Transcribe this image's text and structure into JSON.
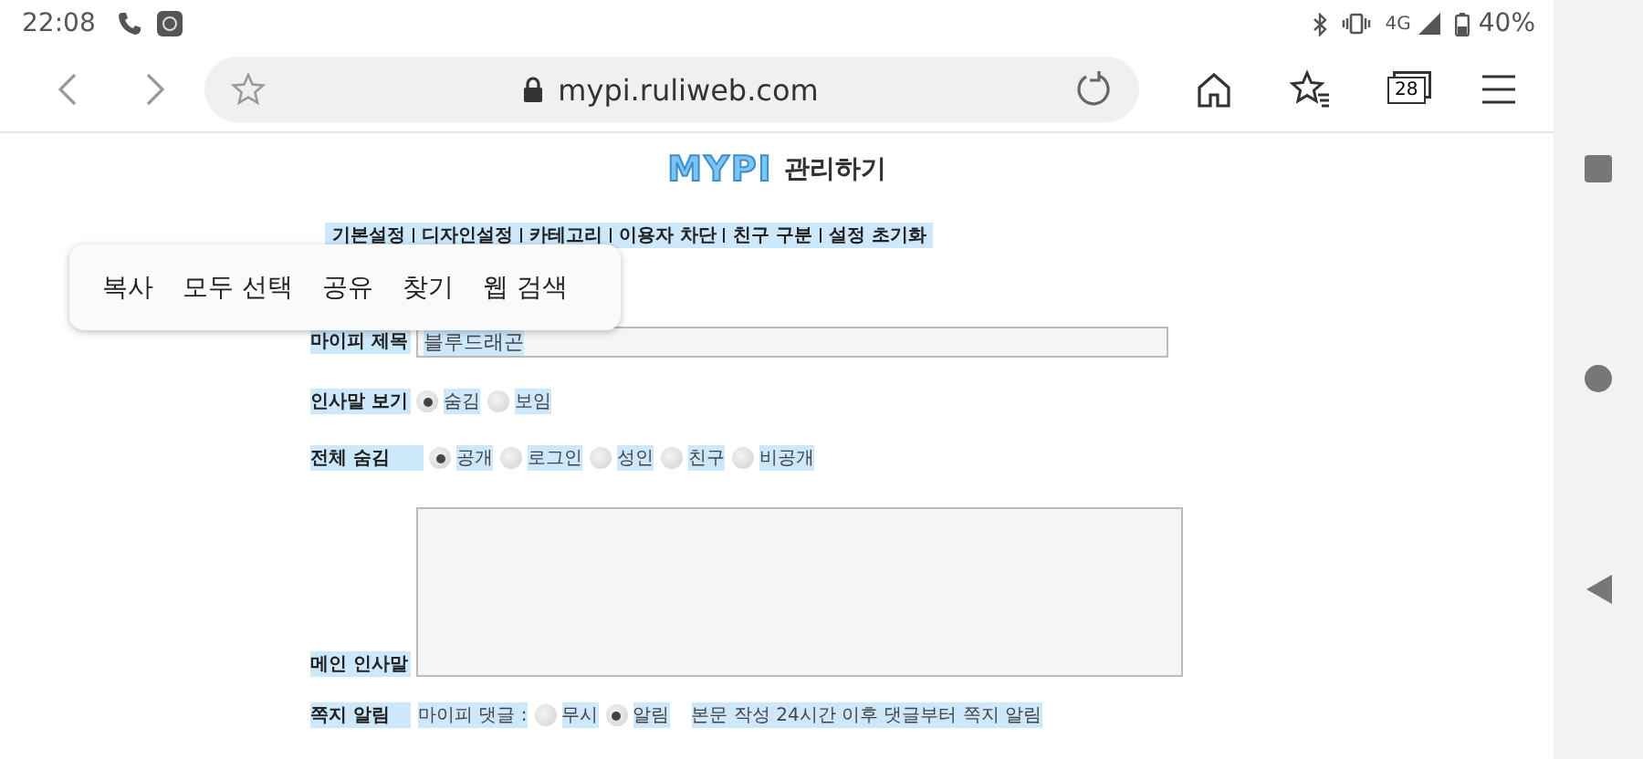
{
  "status_bar": {
    "time": "22:08",
    "network": "4G",
    "battery": "40%"
  },
  "browser": {
    "url": "mypi.ruliweb.com",
    "tab_count": "28"
  },
  "page": {
    "logo": "MYPI",
    "title": "관리하기",
    "menu": [
      "기본설정",
      "디자인설정",
      "카테고리",
      "이용자 차단",
      "친구 구분",
      "설정 초기화"
    ],
    "context_menu": [
      "복사",
      "모두 선택",
      "공유",
      "찾기",
      "웹 검색"
    ],
    "form": [
      {
        "kind": "text",
        "label": "마이피 제목",
        "value": "블루드래곤"
      },
      {
        "kind": "radio",
        "label": "인사말 보기",
        "options": [
          {
            "label": "숨김",
            "selected": true
          },
          {
            "label": "보임",
            "selected": false
          }
        ]
      },
      {
        "kind": "radio",
        "label": "전체 숨김",
        "options": [
          {
            "label": "공개",
            "selected": true
          },
          {
            "label": "로그인",
            "selected": false
          },
          {
            "label": "성인",
            "selected": false
          },
          {
            "label": "친구",
            "selected": false
          },
          {
            "label": "비공개",
            "selected": false
          }
        ]
      },
      {
        "kind": "textarea",
        "label": "메인 인사말"
      },
      {
        "kind": "radio",
        "label": "쪽지 알림",
        "prefix": "마이피 댓글 :",
        "options": [
          {
            "label": "무시",
            "selected": false
          },
          {
            "label": "알림",
            "selected": true
          }
        ],
        "note": "본문 작성 24시간 이후 댓글부터 쪽지 알림"
      }
    ]
  }
}
